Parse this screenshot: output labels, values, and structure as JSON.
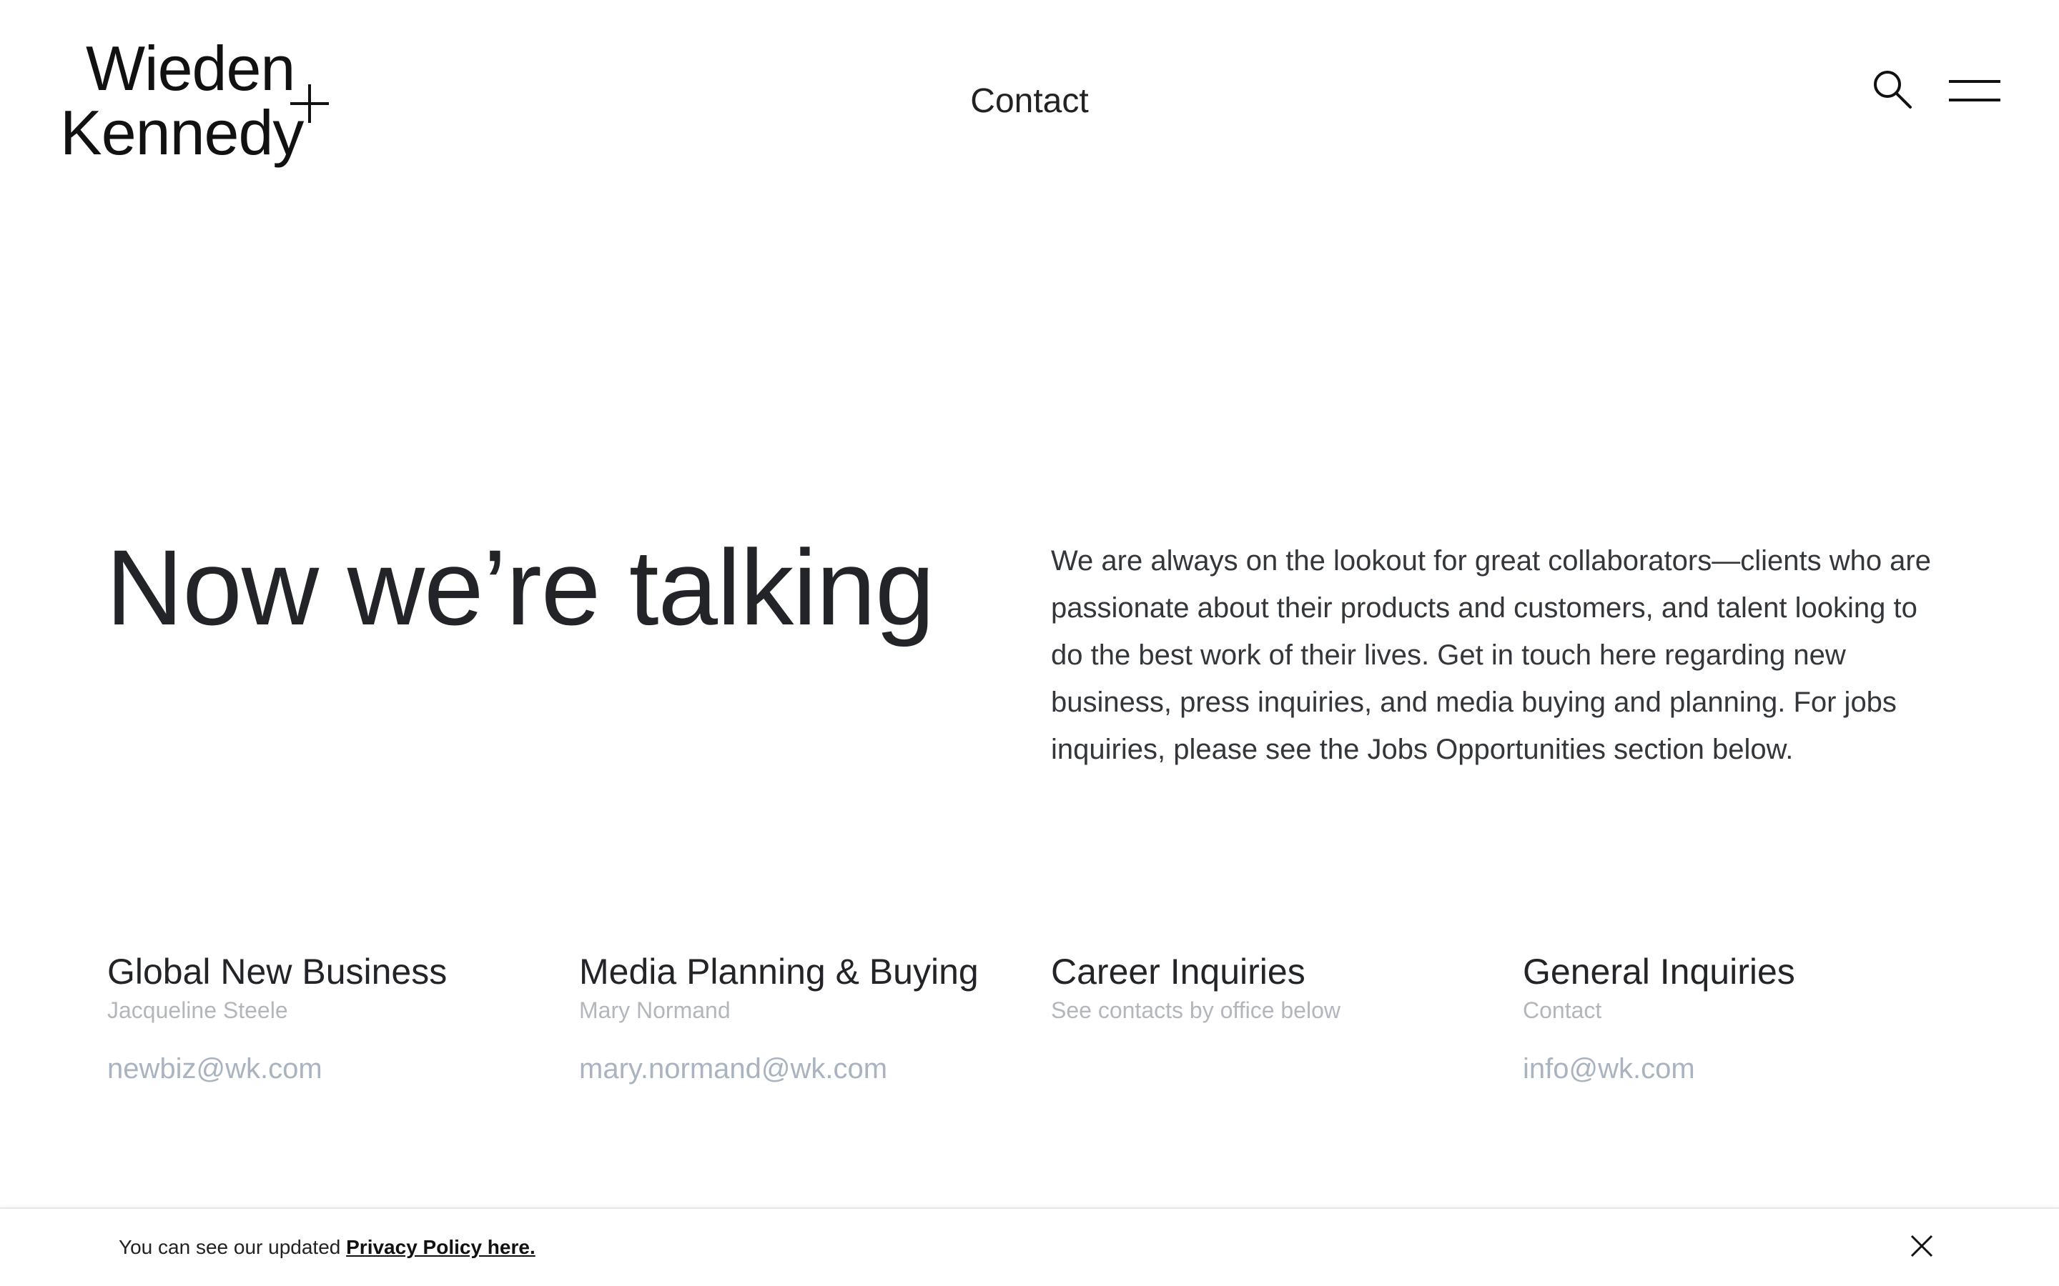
{
  "header": {
    "logo": {
      "line1": "Wieden",
      "line2": "Kennedy",
      "mark": "+"
    },
    "nav_title": "Contact",
    "search_icon": "search-icon",
    "menu_icon": "hamburger-menu-icon"
  },
  "hero": {
    "title": "Now we’re talking",
    "intro": "We are always on the lookout for great collaborators—clients who are passionate about their products and customers, and talent looking to do the best work of their lives. Get in touch here regarding new business, press inquiries, and media buying and planning. For jobs inquiries, please see the Jobs Opportunities section below."
  },
  "contacts": [
    {
      "heading": "Global New Business",
      "person": "Jacqueline Steele",
      "email": "newbiz@wk.com"
    },
    {
      "heading": "Media Planning & Buying",
      "person": "Mary Normand",
      "email": "mary.normand@wk.com"
    },
    {
      "heading": "Career Inquiries",
      "person": "See contacts by office below",
      "email": ""
    },
    {
      "heading": "General Inquiries",
      "person": "Contact",
      "email": "info@wk.com"
    }
  ],
  "privacy_bar": {
    "text": "You can see our updated ",
    "link_label": "Privacy Policy here.",
    "close_icon": "close-icon"
  },
  "colors": {
    "text_primary": "#222428",
    "text_muted": "#b3b7bd",
    "link_muted": "#aab3c0",
    "background": "#ffffff"
  }
}
